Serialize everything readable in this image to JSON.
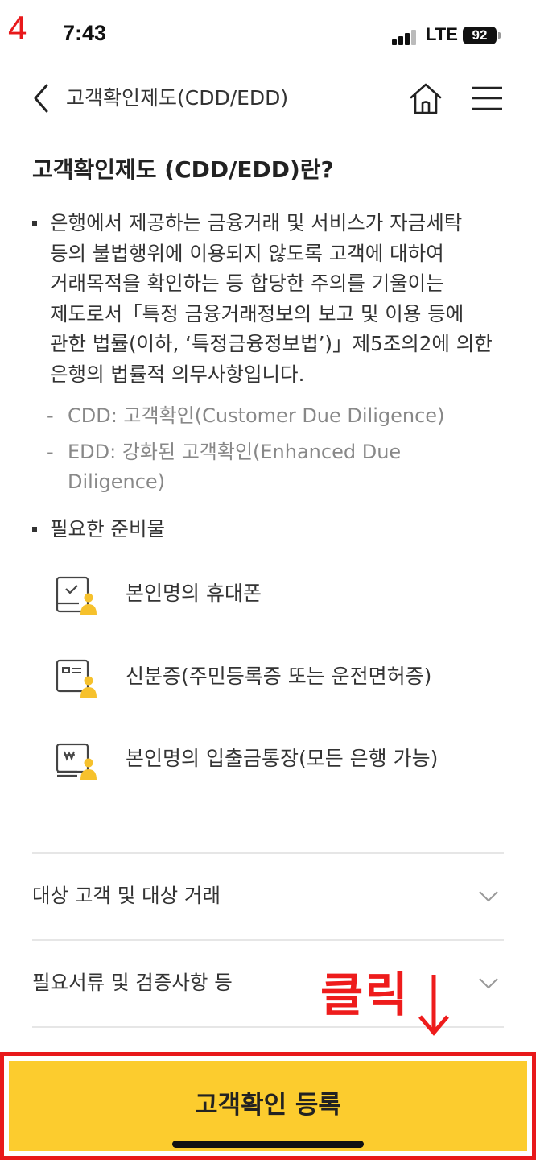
{
  "status_bar": {
    "step": "4",
    "time": "7:43",
    "network": "LTE",
    "battery": "92"
  },
  "header": {
    "title": "고객확인제도(CDD/EDD)"
  },
  "main": {
    "heading": "고객확인제도 (CDD/EDD)란?",
    "intro_lines": [
      "은행에서 제공하는 금융거래 및 서비스가 자금세탁",
      "등의 불법행위에 이용되지 않도록 고객에 대하여",
      "거래목적을 확인하는 등 합당한 주의를 기울이는",
      "제도로서「특정 금융거래정보의 보고 및 이용 등에",
      "관한 법률(이하, ‘특정금융정보법’)」제5조의2에 의한",
      "은행의 법률적 의무사항입니다."
    ],
    "definitions": [
      {
        "mark": "-",
        "lines": [
          "CDD: 고객확인(Customer Due Diligence)"
        ]
      },
      {
        "mark": "-",
        "lines": [
          "EDD: 강화된 고객확인(Enhanced Due",
          "Diligence)"
        ]
      }
    ],
    "prep_heading": "필요한 준비물",
    "prep_items": [
      {
        "icon": "phone-check-person-icon",
        "label": "본인명의 휴대폰"
      },
      {
        "icon": "id-card-person-icon",
        "label": "신분증(주민등록증 또는 운전면허증)"
      },
      {
        "icon": "bankbook-won-person-icon",
        "label": "본인명의 입출금통장(모든 은행 가능)"
      }
    ]
  },
  "accordion": [
    {
      "label": "대상 고객 및 대상 거래",
      "icon": "chevron-down-icon"
    },
    {
      "label": "필요서류 및 검증사항 등",
      "icon": "chevron-down-icon"
    }
  ],
  "annotation": {
    "text": "클릭",
    "arrow": "↓"
  },
  "cta": {
    "label": "고객확인 등록"
  },
  "colors": {
    "accent_yellow": "#fccc2e",
    "annotation_red": "#e8191b",
    "icon_yellow": "#f6c12c",
    "text_dark": "#222222",
    "text_gray": "#888888"
  }
}
